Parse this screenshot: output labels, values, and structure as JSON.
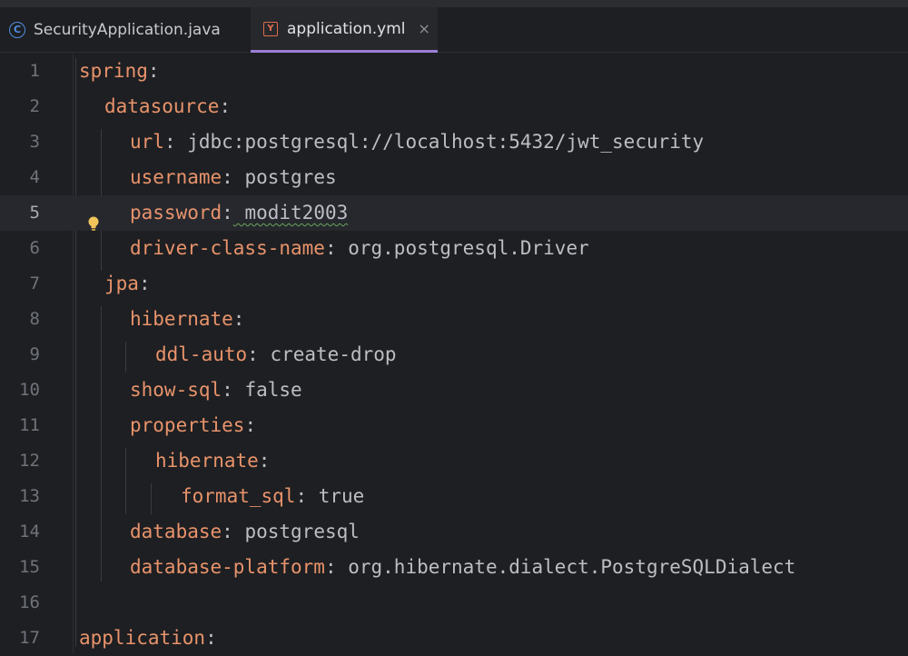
{
  "tabs": [
    {
      "label": "SecurityApplication.java",
      "icon": "java-class-icon",
      "active": false
    },
    {
      "label": "application.yml",
      "icon": "yaml-file-icon",
      "active": true
    }
  ],
  "tab_close_glyph": "×",
  "colors": {
    "key": "#e8936b",
    "value": "#bcbec4",
    "background": "#1e1f22",
    "active_tab_underline": "#9b7fd6"
  },
  "lines": [
    {
      "n": "1",
      "key": "spring",
      "sep": ":",
      "val": ""
    },
    {
      "n": "2",
      "key": "datasource",
      "sep": ":",
      "val": ""
    },
    {
      "n": "3",
      "key": "url",
      "sep": ":",
      "val": " jdbc:postgresql://localhost:5432/jwt_security"
    },
    {
      "n": "4",
      "key": "username",
      "sep": ":",
      "val": " postgres"
    },
    {
      "n": "5",
      "key": "password",
      "sep": ":",
      "val": " modit2003"
    },
    {
      "n": "6",
      "key": "driver-class-name",
      "sep": ":",
      "val": " org.postgresql.Driver"
    },
    {
      "n": "7",
      "key": "jpa",
      "sep": ":",
      "val": ""
    },
    {
      "n": "8",
      "key": "hibernate",
      "sep": ":",
      "val": ""
    },
    {
      "n": "9",
      "key": "ddl-auto",
      "sep": ":",
      "val": " create-drop"
    },
    {
      "n": "10",
      "key": "show-sql",
      "sep": ":",
      "val": " false"
    },
    {
      "n": "11",
      "key": "properties",
      "sep": ":",
      "val": ""
    },
    {
      "n": "12",
      "key": "hibernate",
      "sep": ":",
      "val": ""
    },
    {
      "n": "13",
      "key": "format_sql",
      "sep": ":",
      "val": " true"
    },
    {
      "n": "14",
      "key": "database",
      "sep": ":",
      "val": " postgresql"
    },
    {
      "n": "15",
      "key": "database-platform",
      "sep": ":",
      "val": " org.hibernate.dialect.PostgreSQLDialect"
    },
    {
      "n": "16",
      "key": "",
      "sep": "",
      "val": ""
    },
    {
      "n": "17",
      "key": "application",
      "sep": ":",
      "val": ""
    }
  ]
}
